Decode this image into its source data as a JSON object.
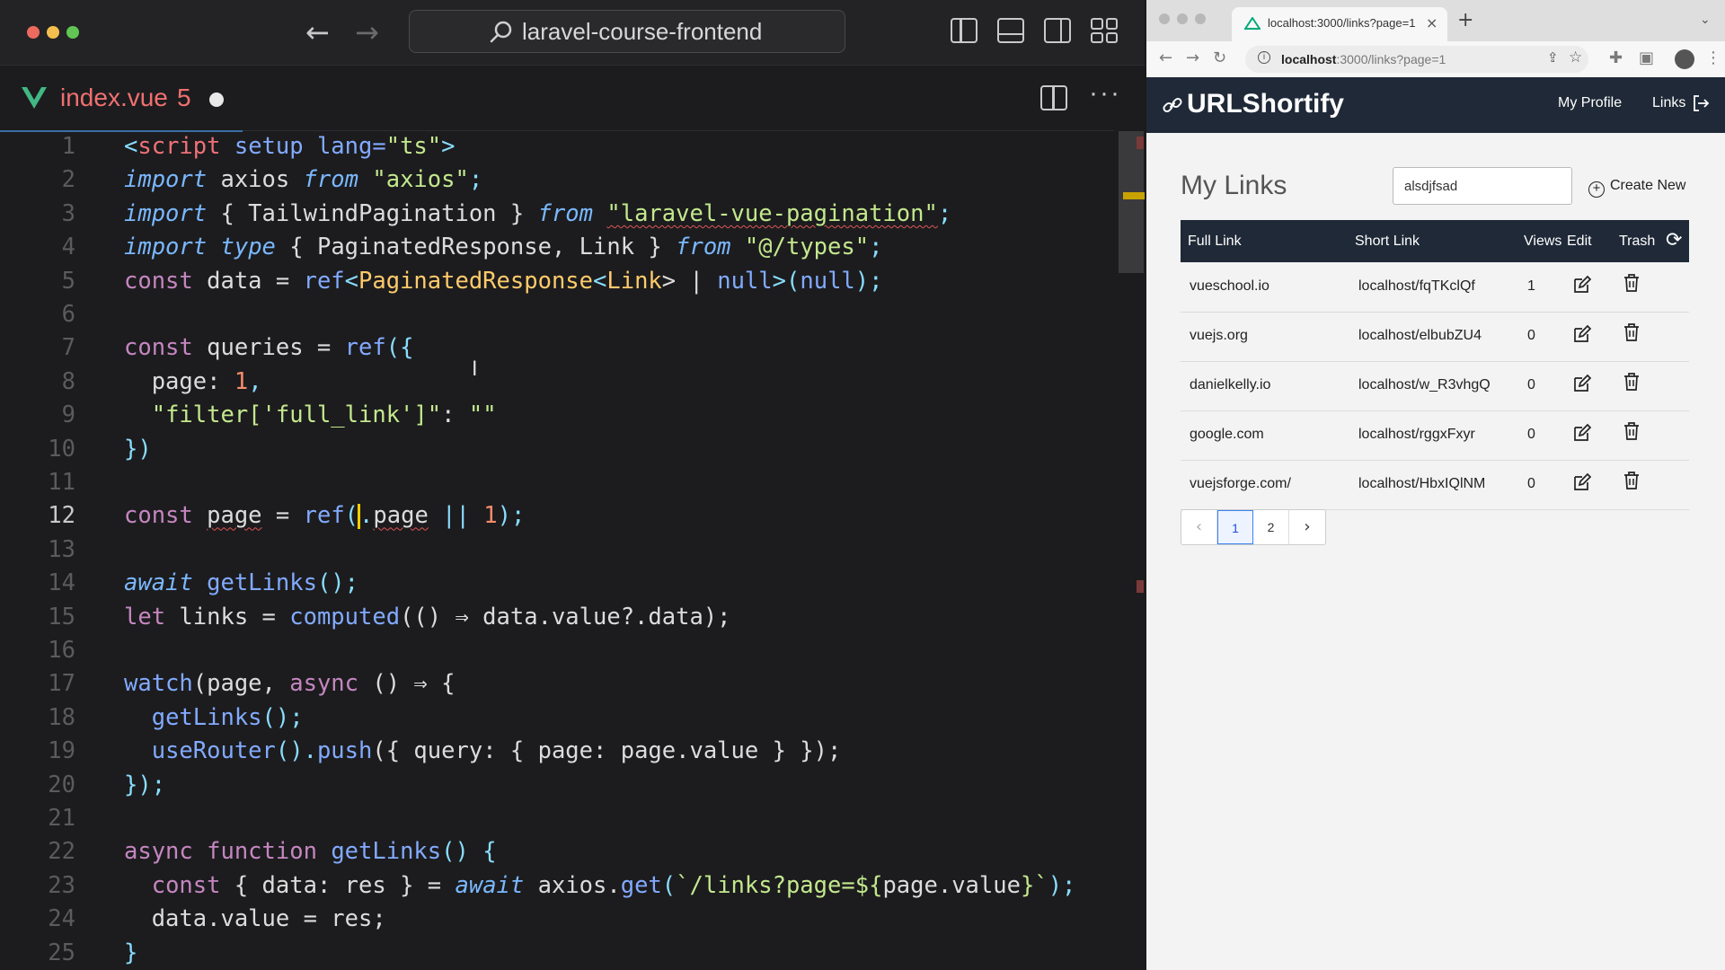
{
  "editor": {
    "command_center_text": "laravel-course-frontend",
    "tab": {
      "filename": "index.vue",
      "problem_count": "5"
    },
    "lines": [
      {
        "n": "1"
      },
      {
        "n": "2"
      },
      {
        "n": "3"
      },
      {
        "n": "4"
      },
      {
        "n": "5"
      },
      {
        "n": "6"
      },
      {
        "n": "7"
      },
      {
        "n": "8"
      },
      {
        "n": "9"
      },
      {
        "n": "10"
      },
      {
        "n": "11"
      },
      {
        "n": "12"
      },
      {
        "n": "13"
      },
      {
        "n": "14"
      },
      {
        "n": "15"
      },
      {
        "n": "16"
      },
      {
        "n": "17"
      },
      {
        "n": "18"
      },
      {
        "n": "19"
      },
      {
        "n": "20"
      },
      {
        "n": "21"
      },
      {
        "n": "22"
      },
      {
        "n": "23"
      },
      {
        "n": "24"
      },
      {
        "n": "25"
      }
    ],
    "active_line": "12"
  },
  "code_tokens": {
    "l1": [
      "<",
      "script",
      " setup lang=",
      "\"ts\"",
      ">"
    ],
    "l2": [
      "import",
      " axios ",
      "from",
      " ",
      "\"axios\"",
      ";"
    ],
    "l3": [
      "import",
      " { TailwindPagination } ",
      "from",
      " ",
      "\"laravel-vue-pagination\"",
      ";"
    ],
    "l4": [
      "import",
      " ",
      "type",
      " { PaginatedResponse, Link } ",
      "from",
      " ",
      "\"@/types\"",
      ";"
    ],
    "l5": [
      "const",
      " data = ",
      "ref",
      "<",
      "PaginatedResponse",
      "<",
      "Link",
      "> | ",
      "null",
      ">(",
      "null",
      ");"
    ],
    "l7": [
      "const",
      " queries = ",
      "ref",
      "({"
    ],
    "l8": [
      "  page: ",
      "1",
      ","
    ],
    "l9": [
      "  ",
      "\"filter['full_link']\"",
      ": ",
      "\"\""
    ],
    "l10": [
      "})"
    ],
    "l12": [
      "const",
      " ",
      "page",
      " = ",
      "ref",
      "(",
      ".",
      "page",
      " || ",
      "1",
      ");"
    ],
    "l14": [
      "await",
      " ",
      "getLinks",
      "();"
    ],
    "l15": [
      "let",
      " links = ",
      "computed",
      "(() ⇒ data.value?.data);"
    ],
    "l17": [
      "watch",
      "(page, ",
      "async",
      " () ⇒ {"
    ],
    "l18": [
      "  ",
      "getLinks",
      "();"
    ],
    "l19": [
      "  ",
      "useRouter",
      "().",
      "push",
      "({ query: { page: page.value } });"
    ],
    "l20": [
      "});"
    ],
    "l22": [
      "async",
      " ",
      "function",
      " ",
      "getLinks",
      "() {"
    ],
    "l23": [
      "  ",
      "const",
      " { data: res } = ",
      "await",
      " axios.",
      "get",
      "(",
      "`/links?page=${",
      "page.value",
      "}`",
      ");"
    ],
    "l24": [
      "  data.value = res;"
    ],
    "l25": [
      "}"
    ]
  },
  "browser": {
    "tab_title": "localhost:3000/links?page=1",
    "url_host": "localhost",
    "url_rest": ":3000/links?page=1",
    "app": {
      "brand": "URLShortify",
      "nav": {
        "profile": "My Profile",
        "links": "Links"
      },
      "page_title": "My Links",
      "search_value": "alsdjfsad",
      "create_label": "Create New",
      "table": {
        "headers": [
          "Full Link",
          "Short Link",
          "Views",
          "Edit",
          "Trash"
        ],
        "rows": [
          {
            "full": "vueschool.io",
            "short": "localhost/fqTKclQf",
            "views": "1"
          },
          {
            "full": "vuejs.org",
            "short": "localhost/elbubZU4",
            "views": "0"
          },
          {
            "full": "danielkelly.io",
            "short": "localhost/w_R3vhgQ",
            "views": "0"
          },
          {
            "full": "google.com",
            "short": "localhost/rggxFxyr",
            "views": "0"
          },
          {
            "full": "vuejsforge.com/",
            "short": "localhost/HbxIQlNM",
            "views": "0"
          }
        ]
      },
      "pagination": {
        "pages": [
          "1",
          "2"
        ],
        "current": "1",
        "prev": "‹",
        "next": "›"
      }
    }
  }
}
